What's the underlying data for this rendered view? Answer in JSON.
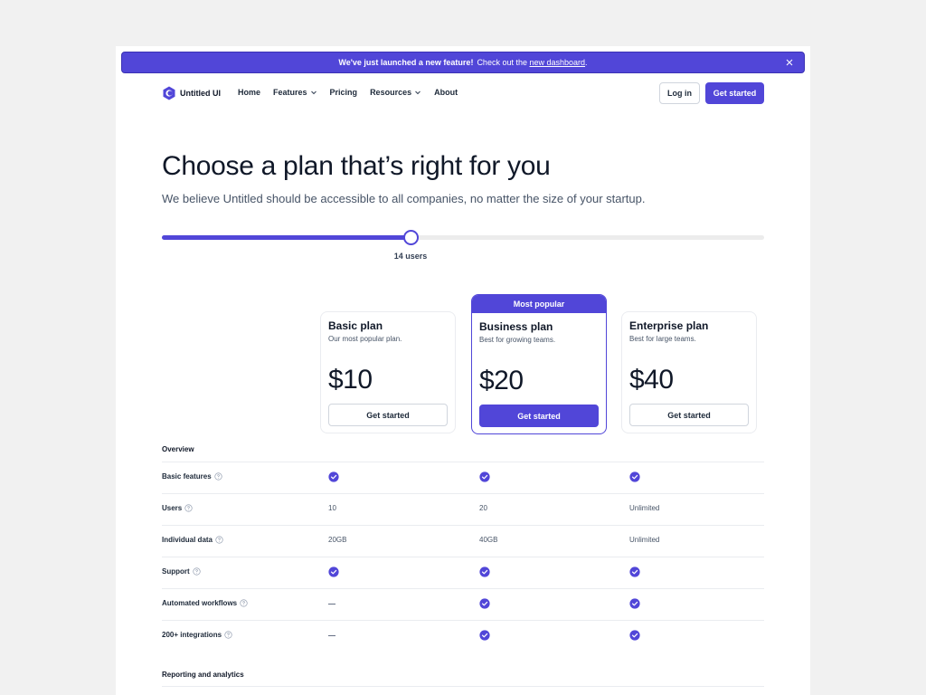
{
  "banner": {
    "strong": "We've just launched a new feature!",
    "text": "Check out the",
    "link": "new dashboard",
    "suffix": "."
  },
  "nav": {
    "brand": "Untitled UI",
    "links": [
      {
        "label": "Home"
      },
      {
        "label": "Features",
        "dropdown": true
      },
      {
        "label": "Pricing"
      },
      {
        "label": "Resources",
        "dropdown": true
      },
      {
        "label": "About"
      }
    ],
    "login": "Log in",
    "get_started": "Get started"
  },
  "hero": {
    "title": "Choose a plan that’s right for you",
    "subtitle": "We believe Untitled should be accessible to all companies, no matter the size of your startup."
  },
  "slider": {
    "label": "14 users",
    "fraction": 0.413
  },
  "plans": [
    {
      "name": "Basic plan",
      "desc": "Our most popular plan.",
      "price": "$10",
      "button": "Get started",
      "featured": false
    },
    {
      "name": "Business plan",
      "desc": "Best for growing teams.",
      "price": "$20",
      "button": "Get started",
      "featured": true,
      "badge": "Most popular"
    },
    {
      "name": "Enterprise plan",
      "desc": "Best for large teams.",
      "price": "$40",
      "button": "Get started",
      "featured": false
    }
  ],
  "table": {
    "overview_title": "Overview",
    "rows": [
      {
        "label": "Basic features",
        "values": [
          "check",
          "check",
          "check"
        ]
      },
      {
        "label": "Users",
        "values": [
          "10",
          "20",
          "Unlimited"
        ]
      },
      {
        "label": "Individual data",
        "values": [
          "20GB",
          "40GB",
          "Unlimited"
        ]
      },
      {
        "label": "Support",
        "values": [
          "check",
          "check",
          "check"
        ]
      },
      {
        "label": "Automated workflows",
        "values": [
          "dash",
          "check",
          "check"
        ]
      },
      {
        "label": "200+ integrations",
        "values": [
          "dash",
          "check",
          "check"
        ]
      }
    ],
    "reporting_title": "Reporting and analytics"
  },
  "colors": {
    "accent": "#5146d8",
    "text": "#101828",
    "muted": "#475467",
    "border": "#eaecf0",
    "background": "#f1f1f1"
  },
  "icons": {
    "close": "close-icon",
    "logo": "logo-icon",
    "chevron": "chevron-down-icon",
    "help": "help-circle-icon",
    "check": "check-circle-icon"
  }
}
